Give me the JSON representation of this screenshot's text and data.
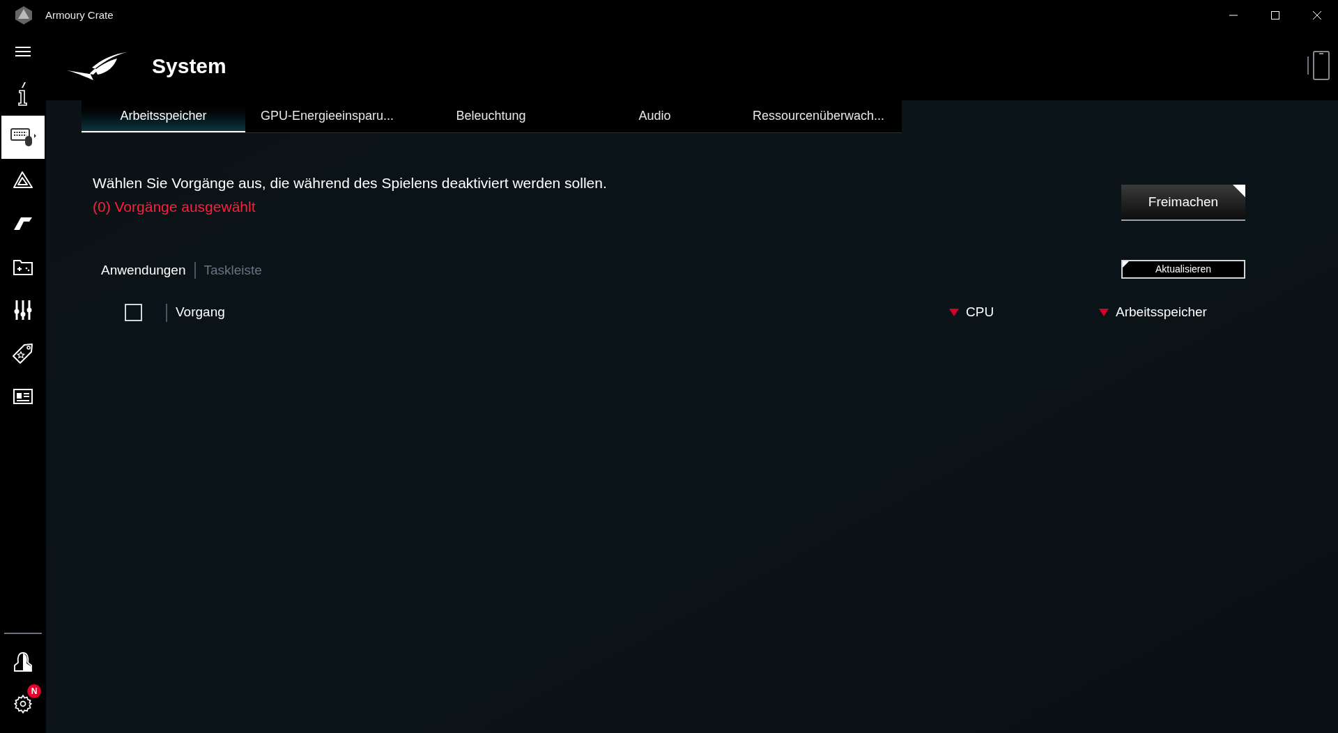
{
  "window": {
    "title": "Armoury Crate"
  },
  "sidebar": {
    "items": [
      {
        "selected": false
      },
      {
        "selected": true
      },
      {
        "selected": false
      },
      {
        "selected": false
      },
      {
        "selected": false
      },
      {
        "selected": false
      },
      {
        "selected": false
      },
      {
        "selected": false
      }
    ],
    "settings_badge": "N"
  },
  "page": {
    "title": "System"
  },
  "tabs": [
    {
      "label": "Arbeitsspeicher",
      "selected": true
    },
    {
      "label": "GPU-Energieeinsparu...",
      "selected": false
    },
    {
      "label": "Beleuchtung",
      "selected": false
    },
    {
      "label": "Audio",
      "selected": false
    },
    {
      "label": "Ressourcenüberwach...",
      "selected": false
    }
  ],
  "description": "Wählen Sie Vorgänge aus, die während des Spielens deaktiviert werden sollen.",
  "selected_count": "(0) Vorgänge ausgewählt",
  "buttons": {
    "primary": "Freimachen",
    "refresh": "Aktualisieren"
  },
  "subtabs": [
    {
      "label": "Anwendungen",
      "selected": true
    },
    {
      "label": "Taskleiste",
      "selected": false
    }
  ],
  "table": {
    "select_all": {
      "checked": false
    },
    "columns": [
      {
        "label": "Vorgang",
        "sorted": false
      },
      {
        "label": "CPU",
        "sorted": true
      },
      {
        "label": "Arbeitsspeicher",
        "sorted": true
      }
    ]
  }
}
